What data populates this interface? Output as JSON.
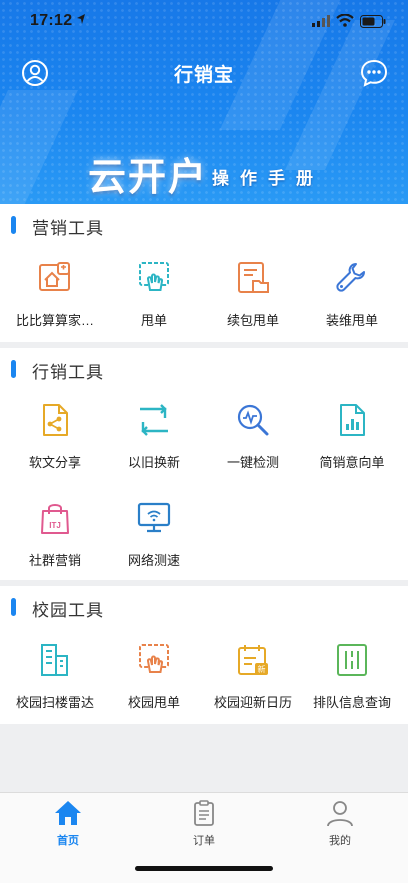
{
  "status_bar": {
    "time": "17:12"
  },
  "header": {
    "title": "行销宝",
    "banner_main": "云开户",
    "banner_sub": "操作手册"
  },
  "sections": [
    {
      "title": "营销工具",
      "items": [
        {
          "label": "比比算算家…",
          "icon": "house-calculator-icon"
        },
        {
          "label": "甩单",
          "icon": "touch-share-icon"
        },
        {
          "label": "续包甩单",
          "icon": "document-folder-icon"
        },
        {
          "label": "装维甩单",
          "icon": "wrench-icon"
        }
      ]
    },
    {
      "title": "行销工具",
      "items": [
        {
          "label": "软文分享",
          "icon": "share-document-icon"
        },
        {
          "label": "以旧换新",
          "icon": "exchange-icon"
        },
        {
          "label": "一键检测",
          "icon": "magnifier-pulse-icon"
        },
        {
          "label": "简销意向单",
          "icon": "chart-document-icon"
        },
        {
          "label": "社群营销",
          "icon": "shopping-bag-icon"
        },
        {
          "label": "网络测速",
          "icon": "monitor-wifi-icon"
        }
      ]
    },
    {
      "title": "校园工具",
      "items": [
        {
          "label": "校园扫楼雷达",
          "icon": "building-radar-icon"
        },
        {
          "label": "校园甩单",
          "icon": "touch-share-icon"
        },
        {
          "label": "校园迎新日历",
          "icon": "calendar-new-icon"
        },
        {
          "label": "排队信息查询",
          "icon": "queue-info-icon"
        }
      ]
    }
  ],
  "tabbar": {
    "tabs": [
      {
        "label": "首页",
        "icon": "home-icon",
        "active": true
      },
      {
        "label": "订单",
        "icon": "clipboard-icon",
        "active": false
      },
      {
        "label": "我的",
        "icon": "person-icon",
        "active": false
      }
    ]
  },
  "colors": {
    "primary": "#1b86f0",
    "orange": "#e8824a",
    "teal": "#2cb5c4",
    "green": "#5bb65a",
    "pink": "#e0598f",
    "gold": "#e6a927"
  }
}
